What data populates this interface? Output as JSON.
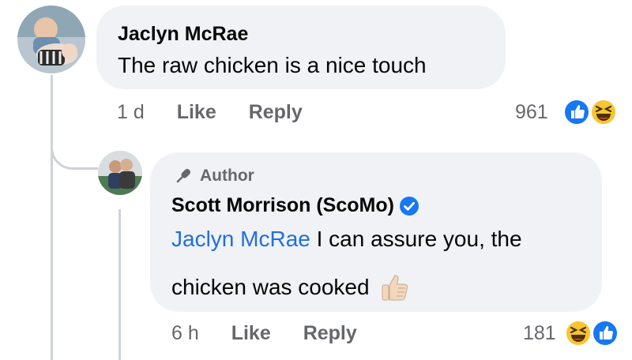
{
  "comment": {
    "author": "Jaclyn McRae",
    "text": "The raw chicken is a nice touch",
    "time": "1 d",
    "like_label": "Like",
    "reply_label": "Reply",
    "reaction_count": "961",
    "reactions": [
      "like-icon",
      "haha-icon"
    ]
  },
  "reply": {
    "badge": "Author",
    "author": "Scott Morrison (ScoMo)",
    "verified": true,
    "mention": "Jaclyn McRae",
    "text_line1": " I can assure you, the",
    "text_line2": "chicken was cooked",
    "text_emoji": "thumbs-up-emoji",
    "time": "6 h",
    "like_label": "Like",
    "reply_label": "Reply",
    "reaction_count": "181",
    "reactions": [
      "haha-icon",
      "like-icon"
    ]
  },
  "colors": {
    "bubble": "#f0f2f5",
    "link": "#216fdb",
    "meta": "#65676b",
    "like_blue": "#1877f2",
    "haha_yellow": "#f7c531"
  }
}
